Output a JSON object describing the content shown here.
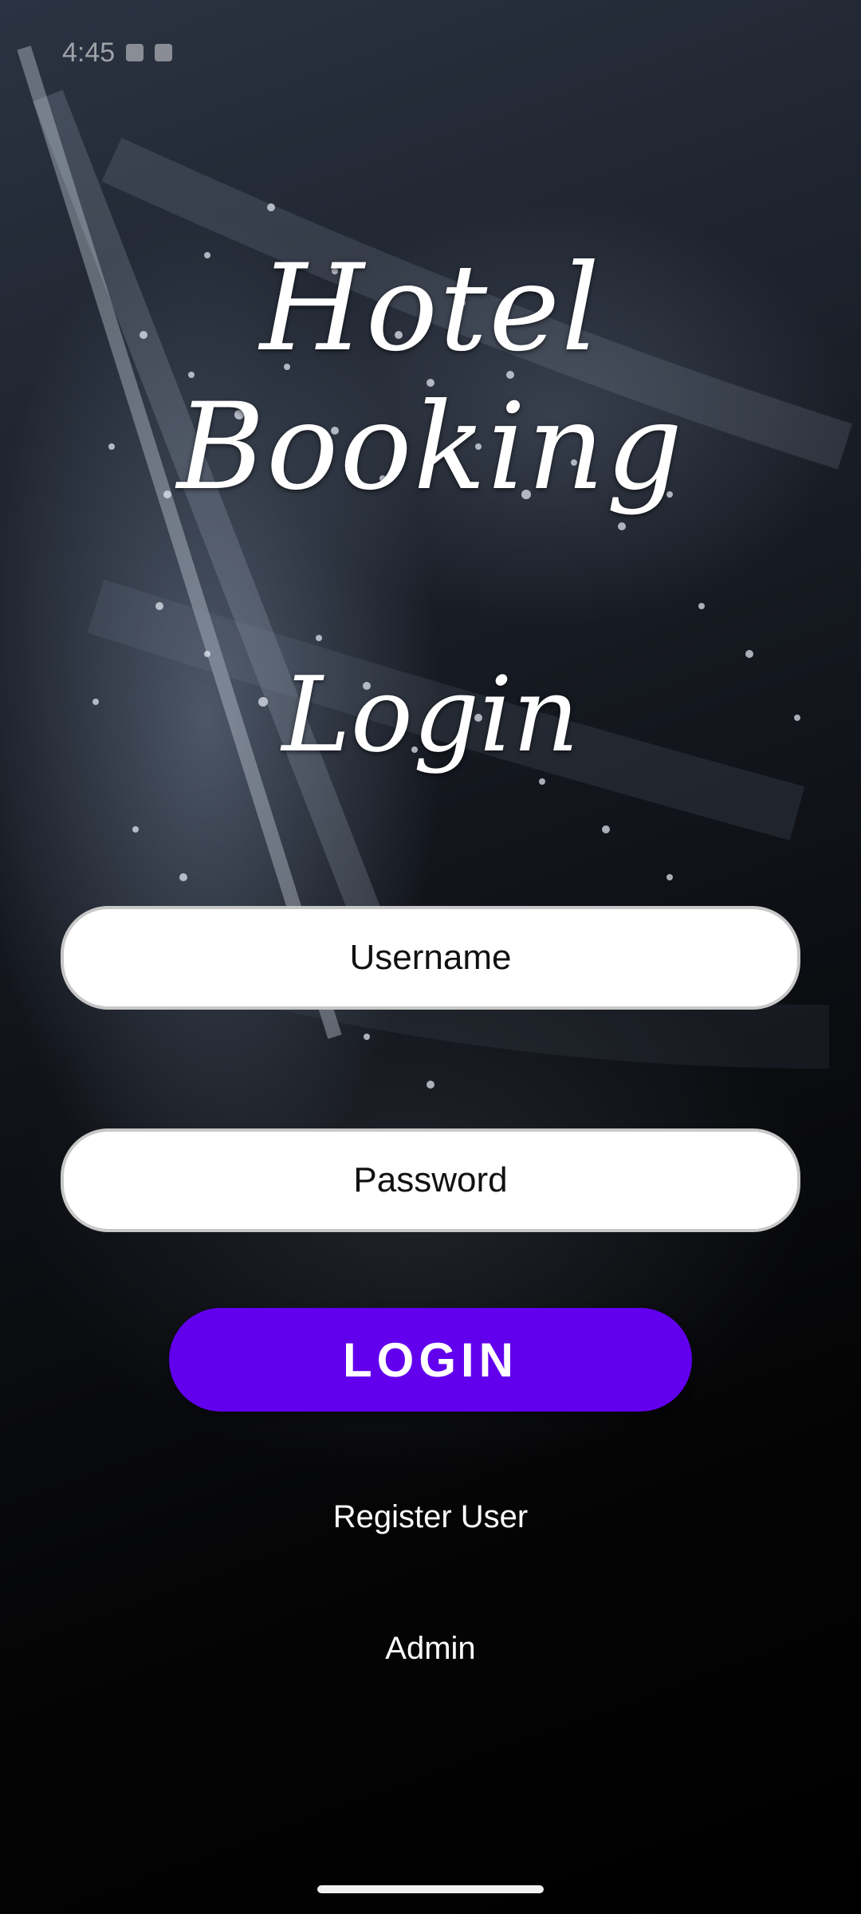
{
  "status_bar": {
    "time": "4:45"
  },
  "header": {
    "app_title": "Hotel Booking",
    "screen_title": "Login"
  },
  "form": {
    "username_placeholder": "Username",
    "password_placeholder": "Password",
    "login_label": "LOGIN"
  },
  "links": {
    "register_label": "Register  User",
    "admin_label": "Admin"
  },
  "colors": {
    "primary_button": "#6200ee",
    "field_background": "#ffffff",
    "text_light": "#ffffff"
  }
}
